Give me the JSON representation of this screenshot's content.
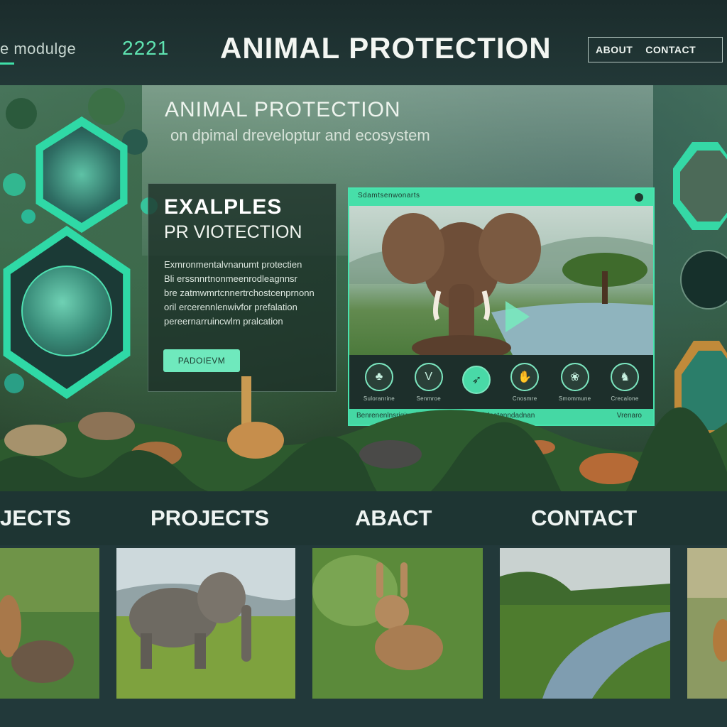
{
  "header": {
    "brand_fragment": "e modulge",
    "year": "2221",
    "title": "ANIMAL PROTECTION",
    "nav": [
      {
        "label": "ABOUT"
      },
      {
        "label": "CONTACT"
      }
    ]
  },
  "hero": {
    "title": "ANIMAL PROTECTION",
    "subtitle": "on dpimal dreveloptur and ecosystem",
    "card": {
      "heading": "EXALPLES",
      "subheading": "PR VIOTECTION",
      "body_lines": [
        "Exmronmentalvnanumt protectien",
        "Bli erssnnrtnonmeenrodleagnnsr",
        "bre zatmwmrtcnnertrchostcenprnonn",
        "oril ercerennlenwivfor prefalation",
        "pereernarruincwlm pralcation"
      ],
      "button_label": "PADOIEVM"
    },
    "video": {
      "header_label": "Sdamtsenwonarts",
      "footer_label": "Benrenenlnsriqirnalnpaprenmoanlmsmninlnatanndadnan",
      "footer_right": "Vrenaro",
      "controls": [
        {
          "label": "Suloranrine",
          "icon": "mushroom-icon",
          "glyph": "♣",
          "active": false
        },
        {
          "label": "Senmroe",
          "icon": "v-icon",
          "glyph": "V",
          "active": false
        },
        {
          "label": "",
          "icon": "feather-icon",
          "glyph": "➶",
          "active": true
        },
        {
          "label": "Cnosmre",
          "icon": "hand-icon",
          "glyph": "✋",
          "active": false
        },
        {
          "label": "Smommune",
          "icon": "swirl-icon",
          "glyph": "❀",
          "active": false
        },
        {
          "label": "Crecalone",
          "icon": "animal-icon",
          "glyph": "♞",
          "active": false
        }
      ]
    }
  },
  "sections": [
    {
      "label": "JECTS"
    },
    {
      "label": "PROJECTS"
    },
    {
      "label": "ABACT"
    },
    {
      "label": "CONTACT"
    }
  ],
  "colors": {
    "accent": "#48e3ae",
    "background": "#1f3433",
    "text": "#eef4f2"
  }
}
